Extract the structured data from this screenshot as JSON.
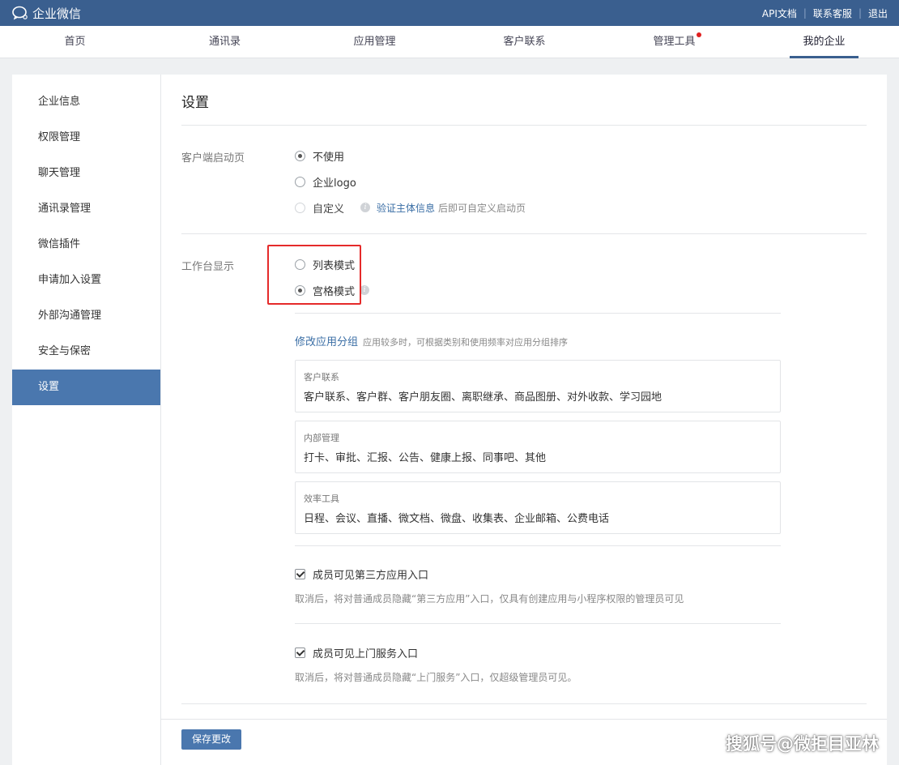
{
  "app": {
    "title": "企业微信"
  },
  "toplinks": [
    "API文档",
    "联系客服",
    "退出"
  ],
  "nav": [
    {
      "label": "首页"
    },
    {
      "label": "通讯录"
    },
    {
      "label": "应用管理"
    },
    {
      "label": "客户联系"
    },
    {
      "label": "管理工具"
    },
    {
      "label": "我的企业"
    }
  ],
  "sidebar": [
    {
      "label": "企业信息"
    },
    {
      "label": "权限管理"
    },
    {
      "label": "聊天管理"
    },
    {
      "label": "通讯录管理"
    },
    {
      "label": "微信插件"
    },
    {
      "label": "申请加入设置"
    },
    {
      "label": "外部沟通管理"
    },
    {
      "label": "安全与保密"
    },
    {
      "label": "设置"
    }
  ],
  "page": {
    "title": "设置"
  },
  "launch": {
    "label": "客户端启动页",
    "options": [
      "不使用",
      "企业logo",
      "自定义"
    ],
    "verify_link": "验证主体信息",
    "verify_hint": "后即可自定义启动页"
  },
  "workbench": {
    "label": "工作台显示",
    "options": [
      "列表模式",
      "宫格模式"
    ],
    "group_link": "修改应用分组",
    "group_hint": "应用较多时，可根据类别和使用频率对应用分组排序",
    "groups": [
      {
        "title": "客户联系",
        "items": "客户联系、客户群、客户朋友圈、离职继承、商品图册、对外收款、学习园地"
      },
      {
        "title": "内部管理",
        "items": "打卡、审批、汇报、公告、健康上报、同事吧、其他"
      },
      {
        "title": "效率工具",
        "items": "日程、会议、直播、微文档、微盘、收集表、企业邮箱、公费电话"
      }
    ],
    "third_party_label": "成员可见第三方应用入口",
    "third_party_desc": "取消后，将对普通成员隐藏“第三方应用”入口，仅具有创建应用与小程序权限的管理员可见",
    "onsite_label": "成员可见上门服务入口",
    "onsite_desc": "取消后，将对普通成员隐藏“上门服务”入口，仅超级管理员可见。"
  },
  "save_label": "保存更改",
  "watermark": "搜狐号@微拒目亚林",
  "colors": {
    "header": "#3a5f8f",
    "accent": "#4a77ae",
    "highlight_box": "#e52a2a",
    "notify_dot": "#e02020"
  }
}
